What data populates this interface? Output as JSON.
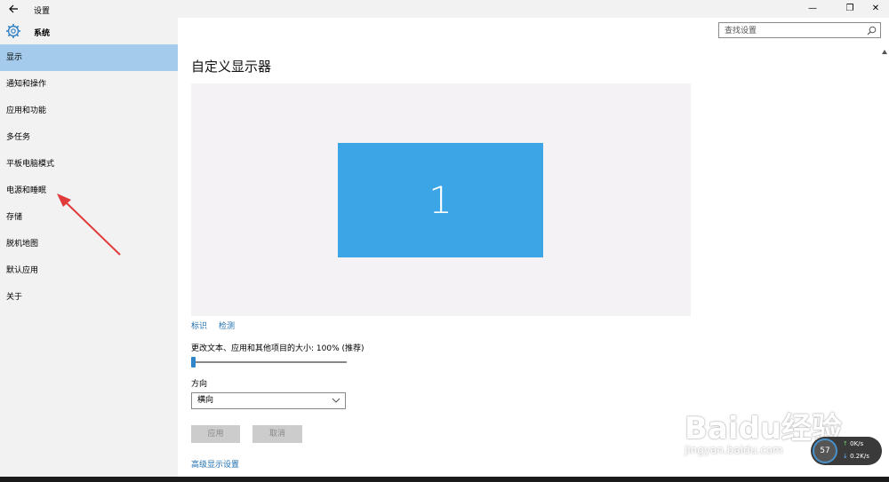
{
  "window": {
    "title": "设置",
    "minimize": "—",
    "restore": "❐",
    "close": "✕"
  },
  "sidebar": {
    "header": "系统",
    "items": [
      {
        "label": "显示",
        "active": true
      },
      {
        "label": "通知和操作"
      },
      {
        "label": "应用和功能"
      },
      {
        "label": "多任务"
      },
      {
        "label": "平板电脑模式"
      },
      {
        "label": "电源和睡眠"
      },
      {
        "label": "存储"
      },
      {
        "label": "脱机地图"
      },
      {
        "label": "默认应用"
      },
      {
        "label": "关于"
      }
    ]
  },
  "search": {
    "placeholder": "查找设置"
  },
  "main": {
    "title": "自定义显示器",
    "monitor_number": "1",
    "identify": "标识",
    "detect": "检测",
    "scale_label": "更改文本、应用和其他项目的大小: 100% (推荐)",
    "scale_value_percent": 100,
    "orientation_label": "方向",
    "orientation_value": "横向",
    "apply": "应用",
    "cancel": "取消",
    "advanced": "高级显示设置"
  },
  "overlay": {
    "watermark": "Baidu经验",
    "watermark_sub": "jingyan.baidu.com",
    "net_percent": "57",
    "net_up": "0K/s",
    "net_down": "0.2K/s"
  },
  "colors": {
    "accent": "#3ba5e6",
    "active_nav": "#a4cbeb",
    "link": "#1f6fb1",
    "arrow": "#e03a3a"
  }
}
